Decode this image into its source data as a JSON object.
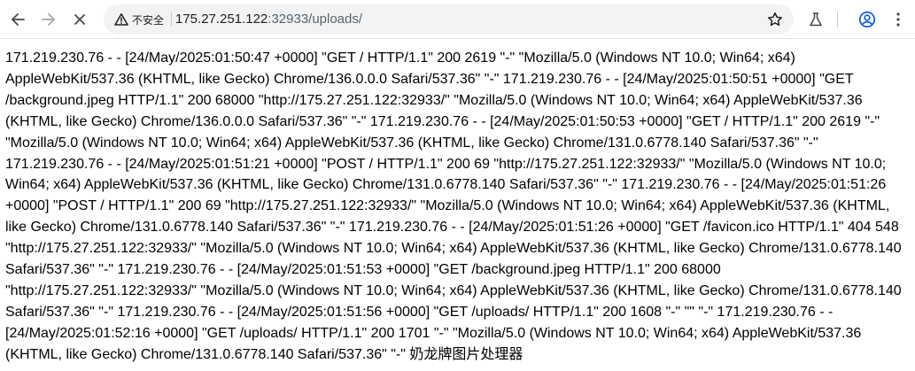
{
  "browser": {
    "security_chip_label": "不安全",
    "url_host": "175.27.251.122",
    "url_path": ":32933/uploads/",
    "icons": {
      "back": "arrow-left-icon",
      "forward": "arrow-right-icon",
      "stop": "close-icon",
      "site_info": "warning-triangle-icon",
      "bookmark": "star-outline-icon",
      "labs": "flask-icon",
      "profile": "account-circle-icon",
      "menu": "kebab-menu-icon"
    },
    "colors": {
      "toolbar": "#ffffff",
      "omnibox": "#f1f3f4",
      "icon": "#5f6368",
      "profile_accent": "#0b57d0"
    }
  },
  "page": {
    "log_text": "171.219.230.76 - - [24/May/2025:01:50:47 +0000] \"GET / HTTP/1.1\" 200 2619 \"-\" \"Mozilla/5.0 (Windows NT 10.0; Win64; x64) AppleWebKit/537.36 (KHTML, like Gecko) Chrome/136.0.0.0 Safari/537.36\" \"-\" 171.219.230.76 - - [24/May/2025:01:50:51 +0000] \"GET /background.jpeg HTTP/1.1\" 200 68000 \"http://175.27.251.122:32933/\" \"Mozilla/5.0 (Windows NT 10.0; Win64; x64) AppleWebKit/537.36 (KHTML, like Gecko) Chrome/136.0.0.0 Safari/537.36\" \"-\" 171.219.230.76 - - [24/May/2025:01:50:53 +0000] \"GET / HTTP/1.1\" 200 2619 \"-\" \"Mozilla/5.0 (Windows NT 10.0; Win64; x64) AppleWebKit/537.36 (KHTML, like Gecko) Chrome/131.0.6778.140 Safari/537.36\" \"-\" 171.219.230.76 - - [24/May/2025:01:51:21 +0000] \"POST / HTTP/1.1\" 200 69 \"http://175.27.251.122:32933/\" \"Mozilla/5.0 (Windows NT 10.0; Win64; x64) AppleWebKit/537.36 (KHTML, like Gecko) Chrome/131.0.6778.140 Safari/537.36\" \"-\" 171.219.230.76 - - [24/May/2025:01:51:26 +0000] \"POST / HTTP/1.1\" 200 69 \"http://175.27.251.122:32933/\" \"Mozilla/5.0 (Windows NT 10.0; Win64; x64) AppleWebKit/537.36 (KHTML, like Gecko) Chrome/131.0.6778.140 Safari/537.36\" \"-\" 171.219.230.76 - - [24/May/2025:01:51:26 +0000] \"GET /favicon.ico HTTP/1.1\" 404 548 \"http://175.27.251.122:32933/\" \"Mozilla/5.0 (Windows NT 10.0; Win64; x64) AppleWebKit/537.36 (KHTML, like Gecko) Chrome/131.0.6778.140 Safari/537.36\" \"-\" 171.219.230.76 - - [24/May/2025:01:51:53 +0000] \"GET /background.jpeg HTTP/1.1\" 200 68000 \"http://175.27.251.122:32933/\" \"Mozilla/5.0 (Windows NT 10.0; Win64; x64) AppleWebKit/537.36 (KHTML, like Gecko) Chrome/131.0.6778.140 Safari/537.36\" \"-\" 171.219.230.76 - - [24/May/2025:01:51:56 +0000] \"GET /uploads/ HTTP/1.1\" 200 1608 \"-\" \"\" \"-\" 171.219.230.76 - - [24/May/2025:01:52:16 +0000] \"GET /uploads/ HTTP/1.1\" 200 1701 \"-\" \"Mozilla/5.0 (Windows NT 10.0; Win64; x64) AppleWebKit/537.36 (KHTML, like Gecko) Chrome/131.0.6778.140 Safari/537.36\" \"-\" 奶龙牌图片处理器"
  }
}
